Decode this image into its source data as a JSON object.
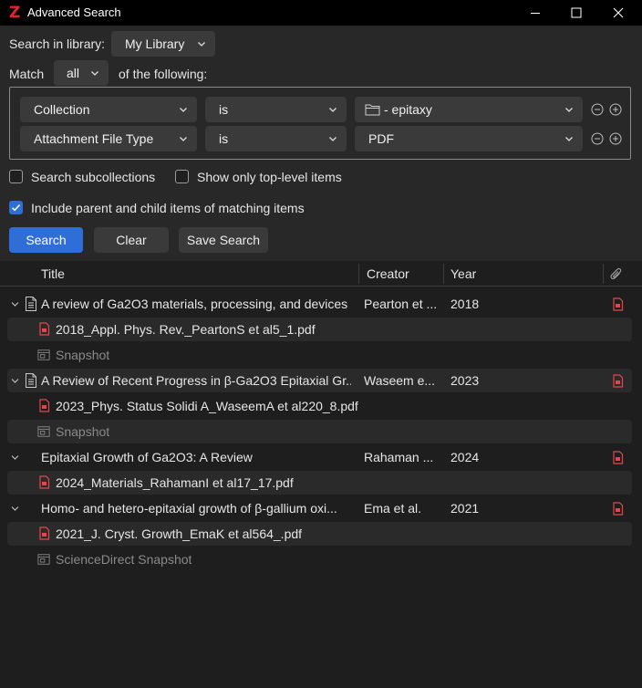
{
  "window": {
    "logo": "Z",
    "title": "Advanced Search"
  },
  "search_in": {
    "label": "Search in library:",
    "value": "My Library"
  },
  "match": {
    "label": "Match",
    "value": "all",
    "suffix": "of the following:"
  },
  "conditions": [
    {
      "field": "Collection",
      "operator": "is",
      "value": "- epitaxy",
      "value_icon": "folder-icon"
    },
    {
      "field": "Attachment File Type",
      "operator": "is",
      "value": "PDF"
    }
  ],
  "options": {
    "search_subcollections": {
      "label": "Search subcollections",
      "checked": false
    },
    "top_level_only": {
      "label": "Show only top-level items",
      "checked": false
    },
    "include_parent_child": {
      "label": "Include parent and child items of matching items",
      "checked": true
    }
  },
  "buttons": {
    "search": "Search",
    "clear": "Clear",
    "save": "Save Search"
  },
  "columns": {
    "title": "Title",
    "creator": "Creator",
    "year": "Year",
    "attachment_icon": "paperclip-icon"
  },
  "items": [
    {
      "title": "A review of Ga2O3 materials, processing, and devices",
      "creator": "Pearton et ...",
      "year": "2018",
      "children": [
        {
          "title": "2018_Appl. Phys. Rev._PeartonS et al5_1.pdf",
          "type": "pdf"
        },
        {
          "title": "Snapshot",
          "type": "snapshot"
        }
      ]
    },
    {
      "title": "A Review of Recent Progress in β-Ga2O3 Epitaxial Gr...",
      "creator": "Waseem e...",
      "year": "2023",
      "children": [
        {
          "title": "2023_Phys. Status Solidi A_WaseemA et al220_8.pdf",
          "type": "pdf"
        },
        {
          "title": "Snapshot",
          "type": "snapshot"
        }
      ]
    },
    {
      "title": "Epitaxial Growth of Ga2O3: A Review",
      "creator": "Rahaman ...",
      "year": "2024",
      "children": [
        {
          "title": "2024_Materials_RahamanI et al17_17.pdf",
          "type": "pdf"
        }
      ]
    },
    {
      "title": "Homo- and hetero-epitaxial growth of β-gallium oxi...",
      "creator": "Ema et al.",
      "year": "2021",
      "children": [
        {
          "title": "2021_J. Cryst. Growth_EmaK et al564_.pdf",
          "type": "pdf"
        },
        {
          "title": "ScienceDirect Snapshot",
          "type": "snapshot"
        }
      ]
    }
  ],
  "colors": {
    "accent": "#2f6ed6",
    "pdf_red": "#e0474c",
    "logo_red": "#e8212e"
  }
}
